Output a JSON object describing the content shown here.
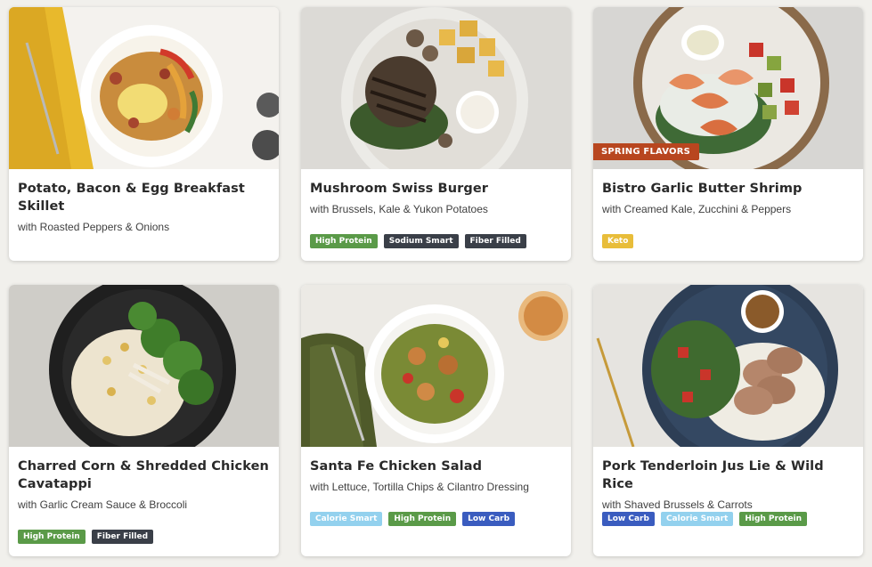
{
  "colors": {
    "page_background": "#f1f0ec",
    "flag": "#b8461f",
    "tag_high_protein": "#5a9a48",
    "tag_sodium_smart": "#3a3f48",
    "tag_fiber_filled": "#3a3f48",
    "tag_keto": "#e8bd3a",
    "tag_calorie_smart": "#93d1ee",
    "tag_low_carb": "#3a5cbf"
  },
  "meals": [
    {
      "title": "Potato, Bacon & Egg Breakfast Skillet",
      "subtitle": "with Roasted Peppers & Onions",
      "flag": "",
      "tags": [],
      "photo": "breakfast-skillet-photo"
    },
    {
      "title": "Mushroom Swiss Burger",
      "subtitle": "with Brussels, Kale & Yukon Potatoes",
      "flag": "",
      "tags": [
        {
          "label": "High Protein",
          "color": "#5a9a48"
        },
        {
          "label": "Sodium Smart",
          "color": "#3a3f48"
        },
        {
          "label": "Fiber Filled",
          "color": "#3a3f48"
        }
      ],
      "photo": "burger-photo"
    },
    {
      "title": "Bistro Garlic Butter Shrimp",
      "subtitle": "with Creamed Kale, Zucchini & Peppers",
      "flag": "SPRING FLAVORS",
      "tags": [
        {
          "label": "Keto",
          "color": "#e8bd3a"
        }
      ],
      "photo": "shrimp-photo"
    },
    {
      "title": "Charred Corn & Shredded Chicken Cavatappi",
      "subtitle": "with Garlic Cream Sauce & Broccoli",
      "flag": "",
      "tags": [
        {
          "label": "High Protein",
          "color": "#5a9a48"
        },
        {
          "label": "Fiber Filled",
          "color": "#3a3f48"
        }
      ],
      "photo": "cavatappi-photo"
    },
    {
      "title": "Santa Fe Chicken Salad",
      "subtitle": "with Lettuce, Tortilla Chips & Cilantro Dressing",
      "flag": "",
      "tags": [
        {
          "label": "Calorie Smart",
          "color": "#93d1ee"
        },
        {
          "label": "High Protein",
          "color": "#5a9a48"
        },
        {
          "label": "Low Carb",
          "color": "#3a5cbf"
        }
      ],
      "photo": "salad-photo"
    },
    {
      "title": "Pork Tenderloin Jus Lie & Wild Rice",
      "subtitle": "with Shaved Brussels & Carrots",
      "flag": "",
      "tags": [
        {
          "label": "Low Carb",
          "color": "#3a5cbf"
        },
        {
          "label": "Calorie Smart",
          "color": "#93d1ee"
        },
        {
          "label": "High Protein",
          "color": "#5a9a48"
        }
      ],
      "photo": "pork-photo"
    }
  ]
}
